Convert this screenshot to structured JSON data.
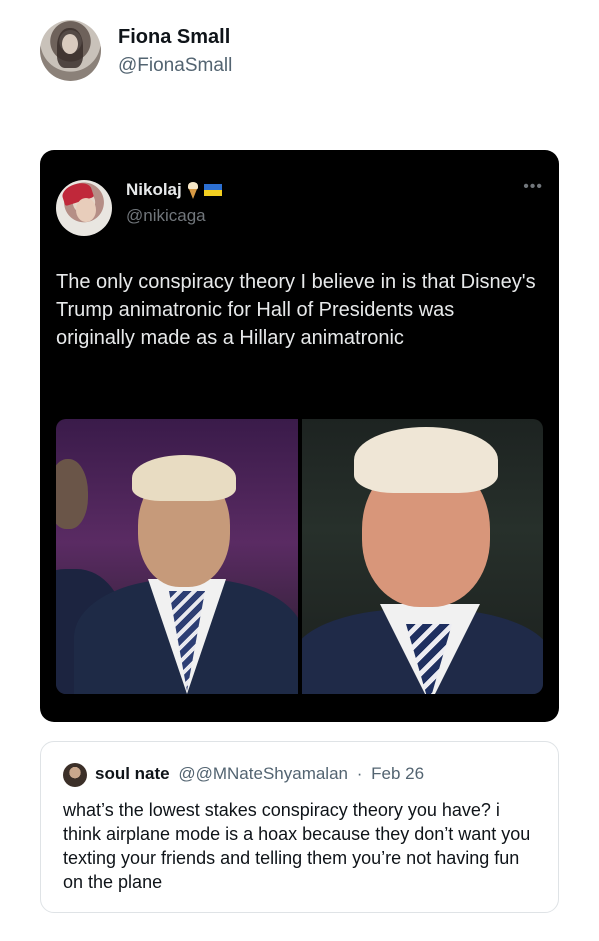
{
  "outer_tweet": {
    "author_name": "Fiona Small",
    "author_handle": "@FionaSmall"
  },
  "embedded_tweet": {
    "author_name": "Nikolaj",
    "author_badges": [
      "ice-cream-icon",
      "ukraine-flag-icon"
    ],
    "author_handle": "@nikicaga",
    "more_label": "•••",
    "text": "The only conspiracy theory I believe in is that Disney's Trump animatronic for Hall of Presidents was originally made as a Hillary animatronic",
    "images": [
      "animatronic-photo-old",
      "animatronic-photo-new"
    ]
  },
  "quoted_tweet": {
    "author_name": "soul nate",
    "author_handle": "@@MNateShyamalan",
    "separator": "·",
    "date": "Feb 26",
    "text": "what’s the lowest stakes conspiracy theory you have? i think airplane mode is a hoax because they don’t want you texting your friends and telling them you’re not having fun on the plane"
  },
  "colors": {
    "card_background": "#000000",
    "primary_text_dark": "#e7e9ea",
    "secondary_text": "#536471",
    "quote_border": "#dfe3e6"
  }
}
